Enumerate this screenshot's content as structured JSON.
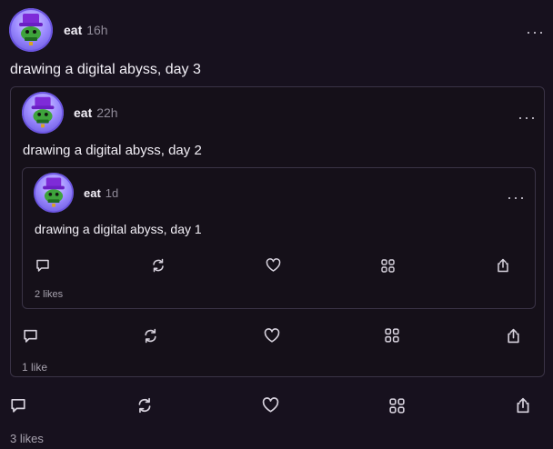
{
  "outer": {
    "author": "eat",
    "time": "16h",
    "text": "drawing a digital abyss, day 3",
    "likes": "3 likes"
  },
  "middle": {
    "author": "eat",
    "time": "22h",
    "text": "drawing a digital abyss, day 2",
    "likes": "1 like"
  },
  "inner": {
    "author": "eat",
    "time": "1d",
    "text": "drawing a digital abyss, day 1",
    "likes": "2 likes"
  },
  "icons": {
    "reply": "comment-icon",
    "recast": "recast-icon",
    "like": "heart-icon",
    "grid": "apps-grid-icon",
    "share": "share-icon",
    "more": "more-options-icon"
  },
  "colors": {
    "background": "#17111e",
    "card_border": "#3a3346",
    "avatar_ring": "#6b55e0",
    "muted": "#8f8a98"
  }
}
